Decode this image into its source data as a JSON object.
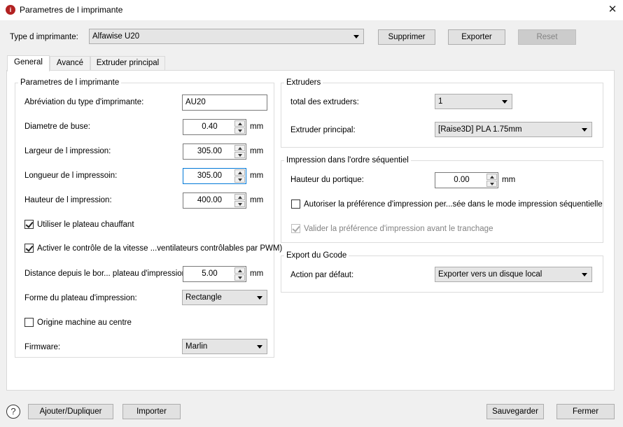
{
  "window": {
    "title": "Parametres de l imprimante",
    "close_glyph": "✕",
    "app_icon_glyph": "i"
  },
  "header": {
    "printer_type_label": "Type d imprimante:",
    "printer_type_value": "Alfawise U20",
    "delete_button": "Supprimer",
    "export_button": "Exporter",
    "reset_button": "Reset"
  },
  "tabs": [
    {
      "label": "General",
      "active": true
    },
    {
      "label": "Avancé",
      "active": false
    },
    {
      "label": "Extruder principal",
      "active": false
    }
  ],
  "printer_params": {
    "group_title": "Parametres de l imprimante",
    "abbrev_label": "Abréviation du type d'imprimante:",
    "abbrev_value": "AU20",
    "nozzle_label": "Diametre de buse:",
    "nozzle_value": "0.40",
    "width_label": "Largeur de l impression:",
    "width_value": "305.00",
    "length_label": "Longueur de l impressoin:",
    "length_value": "305.00",
    "height_label": "Hauteur de l impression:",
    "height_value": "400.00",
    "unit": "mm",
    "heated_bed_label": "Utiliser le plateau chauffant",
    "heated_bed_checked": true,
    "fan_speed_label": "Activer le contrôle de la vitesse ...ventilateurs contrôlables par PWM)",
    "fan_speed_checked": true,
    "edge_distance_label": "Distance depuis le bor... plateau d'impression:",
    "edge_distance_value": "5.00",
    "bed_shape_label": "Forme du plateau d'impression:",
    "bed_shape_value": "Rectangle",
    "origin_center_label": "Origine machine au centre",
    "origin_center_checked": false,
    "firmware_label": "Firmware:",
    "firmware_value": "Marlin"
  },
  "extruders": {
    "group_title": "Extruders",
    "total_label": "total des extruders:",
    "total_value": "1",
    "main_label": "Extruder principal:",
    "main_value": "[Raise3D] PLA 1.75mm"
  },
  "sequential": {
    "group_title": "Impression dans l'ordre séquentiel",
    "gantry_label": "Hauteur du portique:",
    "gantry_value": "0.00",
    "unit": "mm",
    "allow_pref_label": "Autoriser la préférence d'impression per...sée dans le mode impression séquentielle",
    "allow_pref_checked": false,
    "validate_label": "Valider la préférence d'impression avant le tranchage",
    "validate_checked": true
  },
  "gcode_export": {
    "group_title": "Export du Gcode",
    "action_label": "Action par défaut:",
    "action_value": "Exporter vers un disque local"
  },
  "footer": {
    "help_glyph": "?",
    "add_duplicate_button": "Ajouter/Dupliquer",
    "import_button": "Importer",
    "save_button": "Sauvegarder",
    "close_button": "Fermer"
  }
}
